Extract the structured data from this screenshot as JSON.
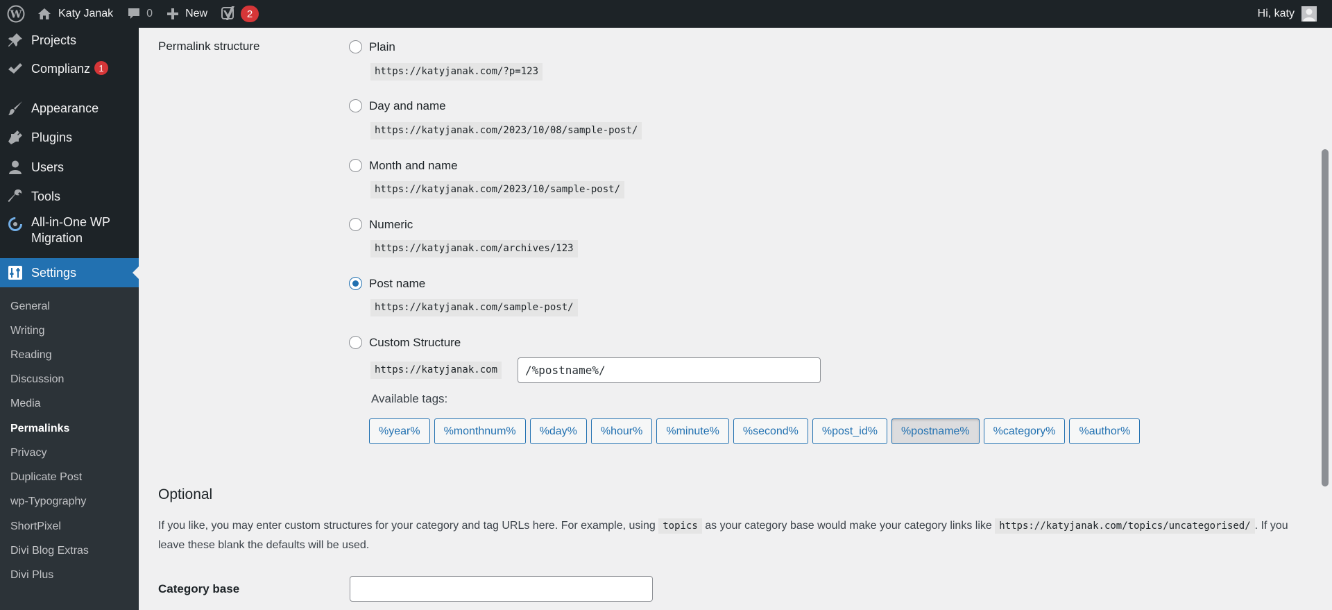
{
  "admin_bar": {
    "site_name": "Katy Janak",
    "comments_count": "0",
    "new_label": "New",
    "yoast_badge": "2",
    "greeting": "Hi, katy"
  },
  "sidebar": {
    "items": [
      {
        "label": "Projects",
        "icon": "pin-icon"
      },
      {
        "label": "Complianz",
        "icon": "check-icon",
        "badge": "1"
      },
      {
        "label": "Appearance",
        "icon": "brush-icon"
      },
      {
        "label": "Plugins",
        "icon": "plug-icon"
      },
      {
        "label": "Users",
        "icon": "user-icon"
      },
      {
        "label": "Tools",
        "icon": "wrench-icon"
      },
      {
        "label": "All-in-One WP",
        "label2": "Migration",
        "icon": "migration-icon"
      },
      {
        "label": "Settings",
        "icon": "settings-icon"
      }
    ],
    "submenu": [
      "General",
      "Writing",
      "Reading",
      "Discussion",
      "Media",
      "Permalinks",
      "Privacy",
      "Duplicate Post",
      "wp-Typography",
      "ShortPixel",
      "Divi Blog Extras",
      "Divi Plus"
    ],
    "active_submenu": "Permalinks"
  },
  "permalinks": {
    "row_label": "Permalink structure",
    "options": [
      {
        "label": "Plain",
        "example": "https://katyjanak.com/?p=123",
        "checked": false
      },
      {
        "label": "Day and name",
        "example": "https://katyjanak.com/2023/10/08/sample-post/",
        "checked": false
      },
      {
        "label": "Month and name",
        "example": "https://katyjanak.com/2023/10/sample-post/",
        "checked": false
      },
      {
        "label": "Numeric",
        "example": "https://katyjanak.com/archives/123",
        "checked": false
      },
      {
        "label": "Post name",
        "example": "https://katyjanak.com/sample-post/",
        "checked": true
      },
      {
        "label": "Custom Structure",
        "example": "https://katyjanak.com",
        "checked": false
      }
    ],
    "custom_value": "/%postname%/",
    "available_tags_label": "Available tags:",
    "tags": [
      "%year%",
      "%monthnum%",
      "%day%",
      "%hour%",
      "%minute%",
      "%second%",
      "%post_id%",
      "%postname%",
      "%category%",
      "%author%"
    ],
    "active_tag": "%postname%"
  },
  "optional": {
    "title": "Optional",
    "desc_part1": "If you like, you may enter custom structures for your category and tag URLs here. For example, using",
    "code1": "topics",
    "desc_part2": "as your category base would make your category links like",
    "code2": "https://katyjanak.com/topics/uncategorised/",
    "desc_part3": ". If you leave these blank the defaults will be used.",
    "category_base_label": "Category base",
    "category_base_value": ""
  }
}
